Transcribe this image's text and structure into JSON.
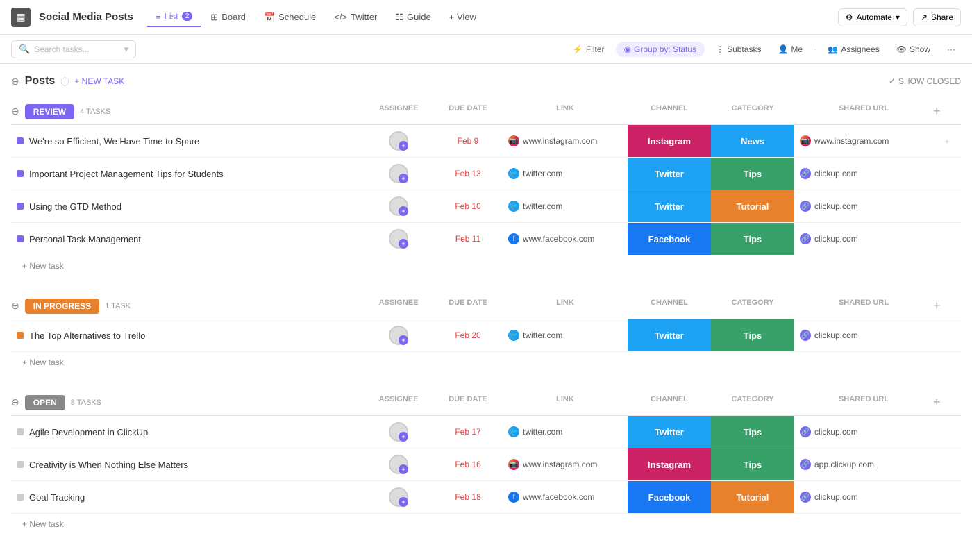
{
  "app": {
    "icon": "▦",
    "title": "Social Media Posts"
  },
  "nav": {
    "tabs": [
      {
        "id": "list",
        "label": "List",
        "badge": "2",
        "active": true,
        "icon": "≡"
      },
      {
        "id": "board",
        "label": "Board",
        "icon": "⊞"
      },
      {
        "id": "schedule",
        "label": "Schedule",
        "icon": "☰"
      },
      {
        "id": "twitter",
        "label": "Twitter",
        "icon": "</>"
      },
      {
        "id": "guide",
        "label": "Guide",
        "icon": "☷"
      }
    ],
    "view_btn": "+ View",
    "automate_btn": "Automate",
    "share_btn": "Share"
  },
  "toolbar": {
    "search_placeholder": "Search tasks...",
    "filter_btn": "Filter",
    "group_by_btn": "Group by: Status",
    "subtasks_btn": "Subtasks",
    "me_btn": "Me",
    "assignees_btn": "Assignees",
    "show_btn": "Show",
    "more_btn": "···"
  },
  "section": {
    "name": "Posts",
    "new_task_label": "+ NEW TASK",
    "show_closed_label": "SHOW CLOSED"
  },
  "groups": [
    {
      "id": "review",
      "label": "REVIEW",
      "type": "review",
      "task_count": "4 TASKS",
      "columns": [
        "ASSIGNEE",
        "DUE DATE",
        "LINK",
        "CHANNEL",
        "CATEGORY",
        "SHARED URL"
      ],
      "tasks": [
        {
          "name": "We're so Efficient, We Have Time to Spare",
          "dot": "purple",
          "due_date": "Feb 9",
          "link_type": "instagram",
          "link_url": "www.instagram.com",
          "channel": "Instagram",
          "channel_type": "instagram",
          "category": "News",
          "category_type": "news",
          "shared_url_type": "instagram",
          "shared_url": "www.instagram.com"
        },
        {
          "name": "Important Project Management Tips for Students",
          "dot": "purple",
          "due_date": "Feb 13",
          "link_type": "twitter",
          "link_url": "twitter.com",
          "channel": "Twitter",
          "channel_type": "twitter",
          "category": "Tips",
          "category_type": "tips",
          "shared_url_type": "clickup",
          "shared_url": "clickup.com"
        },
        {
          "name": "Using the GTD Method",
          "dot": "purple",
          "due_date": "Feb 10",
          "link_type": "twitter",
          "link_url": "twitter.com",
          "channel": "Twitter",
          "channel_type": "twitter",
          "category": "Tutorial",
          "category_type": "tutorial",
          "shared_url_type": "clickup",
          "shared_url": "clickup.com"
        },
        {
          "name": "Personal Task Management",
          "dot": "purple",
          "due_date": "Feb 11",
          "link_type": "facebook",
          "link_url": "www.facebook.com",
          "channel": "Facebook",
          "channel_type": "facebook",
          "category": "Tips",
          "category_type": "tips",
          "shared_url_type": "clickup",
          "shared_url": "clickup.com"
        }
      ]
    },
    {
      "id": "inprogress",
      "label": "IN PROGRESS",
      "type": "inprogress",
      "task_count": "1 TASK",
      "tasks": [
        {
          "name": "The Top Alternatives to Trello",
          "dot": "orange",
          "due_date": "Feb 20",
          "link_type": "twitter",
          "link_url": "twitter.com",
          "channel": "Twitter",
          "channel_type": "twitter",
          "category": "Tips",
          "category_type": "tips",
          "shared_url_type": "clickup",
          "shared_url": "clickup.com"
        }
      ]
    },
    {
      "id": "open",
      "label": "OPEN",
      "type": "open",
      "task_count": "8 TASKS",
      "tasks": [
        {
          "name": "Agile Development in ClickUp",
          "dot": "gray",
          "due_date": "Feb 17",
          "link_type": "twitter",
          "link_url": "twitter.com",
          "channel": "Twitter",
          "channel_type": "twitter",
          "category": "Tips",
          "category_type": "tips",
          "shared_url_type": "clickup",
          "shared_url": "clickup.com"
        },
        {
          "name": "Creativity is When Nothing Else Matters",
          "dot": "gray",
          "due_date": "Feb 16",
          "link_type": "instagram",
          "link_url": "www.instagram.com",
          "channel": "Instagram",
          "channel_type": "instagram",
          "category": "Tips",
          "category_type": "tips",
          "shared_url_type": "clickup",
          "shared_url": "app.clickup.com"
        },
        {
          "name": "Goal Tracking",
          "dot": "gray",
          "due_date": "Feb 18",
          "link_type": "facebook",
          "link_url": "www.facebook.com",
          "channel": "Facebook",
          "channel_type": "facebook",
          "category": "Tutorial",
          "category_type": "tutorial",
          "shared_url_type": "clickup",
          "shared_url": "clickup.com"
        }
      ]
    }
  ],
  "icons": {
    "collapse": "⊖",
    "info": "ⓘ",
    "check": "✓",
    "chevron_down": "▾",
    "search": "🔍",
    "filter": "⚡",
    "group": "◉",
    "people": "👤",
    "eye": "👁",
    "plus": "+",
    "more": "···"
  }
}
